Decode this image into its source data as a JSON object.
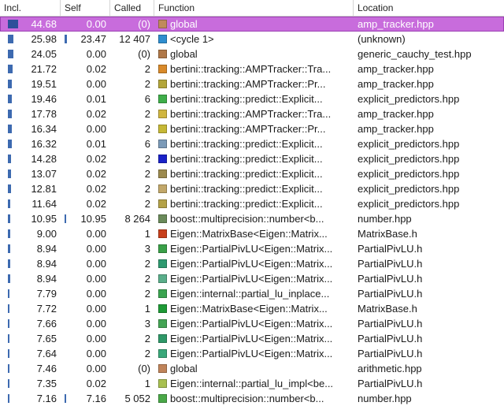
{
  "columns": {
    "incl": "Incl.",
    "self": "Self",
    "called": "Called",
    "function": "Function",
    "location": "Location"
  },
  "rows": [
    {
      "incl": "44.68",
      "incl_pct": 44.68,
      "self": "0.00",
      "self_pct": 0.0,
      "called": "(0)",
      "func": "global",
      "loc": "amp_tracker.hpp",
      "color": "#c08a5c",
      "selected": true
    },
    {
      "incl": "25.98",
      "incl_pct": 25.98,
      "self": "23.47",
      "self_pct": 23.47,
      "called": "12 407",
      "func": "<cycle 1>",
      "loc": "(unknown)",
      "color": "#2e8ecf",
      "selected": false
    },
    {
      "incl": "24.05",
      "incl_pct": 24.05,
      "self": "0.00",
      "self_pct": 0.0,
      "called": "(0)",
      "func": "global",
      "loc": "generic_cauchy_test.hpp",
      "color": "#b07848",
      "selected": false
    },
    {
      "incl": "21.72",
      "incl_pct": 21.72,
      "self": "0.02",
      "self_pct": 0.02,
      "called": "2",
      "func": "bertini::tracking::AMPTracker::Tra...",
      "loc": "amp_tracker.hpp",
      "color": "#d98a2a",
      "selected": false
    },
    {
      "incl": "19.51",
      "incl_pct": 19.51,
      "self": "0.00",
      "self_pct": 0.0,
      "called": "2",
      "func": "bertini::tracking::AMPTracker::Pr...",
      "loc": "amp_tracker.hpp",
      "color": "#b3a63a",
      "selected": false
    },
    {
      "incl": "19.46",
      "incl_pct": 19.46,
      "self": "0.01",
      "self_pct": 0.01,
      "called": "6",
      "func": "bertini::tracking::predict::Explicit...",
      "loc": "explicit_predictors.hpp",
      "color": "#3fae4a",
      "selected": false
    },
    {
      "incl": "17.78",
      "incl_pct": 17.78,
      "self": "0.02",
      "self_pct": 0.02,
      "called": "2",
      "func": "bertini::tracking::AMPTracker::Tra...",
      "loc": "amp_tracker.hpp",
      "color": "#d0b640",
      "selected": false
    },
    {
      "incl": "16.34",
      "incl_pct": 16.34,
      "self": "0.00",
      "self_pct": 0.0,
      "called": "2",
      "func": "bertini::tracking::AMPTracker::Pr...",
      "loc": "amp_tracker.hpp",
      "color": "#c6b836",
      "selected": false
    },
    {
      "incl": "16.32",
      "incl_pct": 16.32,
      "self": "0.01",
      "self_pct": 0.01,
      "called": "6",
      "func": "bertini::tracking::predict::Explicit...",
      "loc": "explicit_predictors.hpp",
      "color": "#7b9ab8",
      "selected": false
    },
    {
      "incl": "14.28",
      "incl_pct": 14.28,
      "self": "0.02",
      "self_pct": 0.02,
      "called": "2",
      "func": "bertini::tracking::predict::Explicit...",
      "loc": "explicit_predictors.hpp",
      "color": "#1a22c8",
      "selected": false
    },
    {
      "incl": "13.07",
      "incl_pct": 13.07,
      "self": "0.02",
      "self_pct": 0.02,
      "called": "2",
      "func": "bertini::tracking::predict::Explicit...",
      "loc": "explicit_predictors.hpp",
      "color": "#9c8a4e",
      "selected": false
    },
    {
      "incl": "12.81",
      "incl_pct": 12.81,
      "self": "0.02",
      "self_pct": 0.02,
      "called": "2",
      "func": "bertini::tracking::predict::Explicit...",
      "loc": "explicit_predictors.hpp",
      "color": "#c2a86a",
      "selected": false
    },
    {
      "incl": "11.64",
      "incl_pct": 11.64,
      "self": "0.02",
      "self_pct": 0.02,
      "called": "2",
      "func": "bertini::tracking::predict::Explicit...",
      "loc": "explicit_predictors.hpp",
      "color": "#b4a248",
      "selected": false
    },
    {
      "incl": "10.95",
      "incl_pct": 10.95,
      "self": "10.95",
      "self_pct": 10.95,
      "called": "8 264",
      "func": "boost::multiprecision::number<b...",
      "loc": "number.hpp",
      "color": "#6a8a5a",
      "selected": false
    },
    {
      "incl": "9.00",
      "incl_pct": 9.0,
      "self": "0.00",
      "self_pct": 0.0,
      "called": "1",
      "func": "Eigen::MatrixBase<Eigen::Matrix...",
      "loc": "MatrixBase.h",
      "color": "#c8401c",
      "selected": false
    },
    {
      "incl": "8.94",
      "incl_pct": 8.94,
      "self": "0.00",
      "self_pct": 0.0,
      "called": "3",
      "func": "Eigen::PartialPivLU<Eigen::Matrix...",
      "loc": "PartialPivLU.h",
      "color": "#3aa048",
      "selected": false
    },
    {
      "incl": "8.94",
      "incl_pct": 8.94,
      "self": "0.00",
      "self_pct": 0.0,
      "called": "2",
      "func": "Eigen::PartialPivLU<Eigen::Matrix...",
      "loc": "PartialPivLU.h",
      "color": "#2e9a70",
      "selected": false
    },
    {
      "incl": "8.94",
      "incl_pct": 8.94,
      "self": "0.00",
      "self_pct": 0.0,
      "called": "2",
      "func": "Eigen::PartialPivLU<Eigen::Matrix...",
      "loc": "PartialPivLU.h",
      "color": "#5aae8a",
      "selected": false
    },
    {
      "incl": "7.79",
      "incl_pct": 7.79,
      "self": "0.00",
      "self_pct": 0.0,
      "called": "2",
      "func": "Eigen::internal::partial_lu_inplace...",
      "loc": "PartialPivLU.h",
      "color": "#3aa450",
      "selected": false
    },
    {
      "incl": "7.72",
      "incl_pct": 7.72,
      "self": "0.00",
      "self_pct": 0.0,
      "called": "1",
      "func": "Eigen::MatrixBase<Eigen::Matrix...",
      "loc": "MatrixBase.h",
      "color": "#1e9a36",
      "selected": false
    },
    {
      "incl": "7.66",
      "incl_pct": 7.66,
      "self": "0.00",
      "self_pct": 0.0,
      "called": "3",
      "func": "Eigen::PartialPivLU<Eigen::Matrix...",
      "loc": "PartialPivLU.h",
      "color": "#44a454",
      "selected": false
    },
    {
      "incl": "7.65",
      "incl_pct": 7.65,
      "self": "0.00",
      "self_pct": 0.0,
      "called": "2",
      "func": "Eigen::PartialPivLU<Eigen::Matrix...",
      "loc": "PartialPivLU.h",
      "color": "#2e9868",
      "selected": false
    },
    {
      "incl": "7.64",
      "incl_pct": 7.64,
      "self": "0.00",
      "self_pct": 0.0,
      "called": "2",
      "func": "Eigen::PartialPivLU<Eigen::Matrix...",
      "loc": "PartialPivLU.h",
      "color": "#3aa87a",
      "selected": false
    },
    {
      "incl": "7.46",
      "incl_pct": 7.46,
      "self": "0.00",
      "self_pct": 0.0,
      "called": "(0)",
      "func": "global",
      "loc": "arithmetic.hpp",
      "color": "#c0845a",
      "selected": false
    },
    {
      "incl": "7.35",
      "incl_pct": 7.35,
      "self": "0.02",
      "self_pct": 0.02,
      "called": "1",
      "func": "Eigen::internal::partial_lu_impl<be...",
      "loc": "PartialPivLU.h",
      "color": "#a8c050",
      "selected": false
    },
    {
      "incl": "7.16",
      "incl_pct": 7.16,
      "self": "7.16",
      "self_pct": 7.16,
      "called": "5 052",
      "func": "boost::multiprecision::number<b...",
      "loc": "number.hpp",
      "color": "#4aa848",
      "selected": false
    }
  ]
}
